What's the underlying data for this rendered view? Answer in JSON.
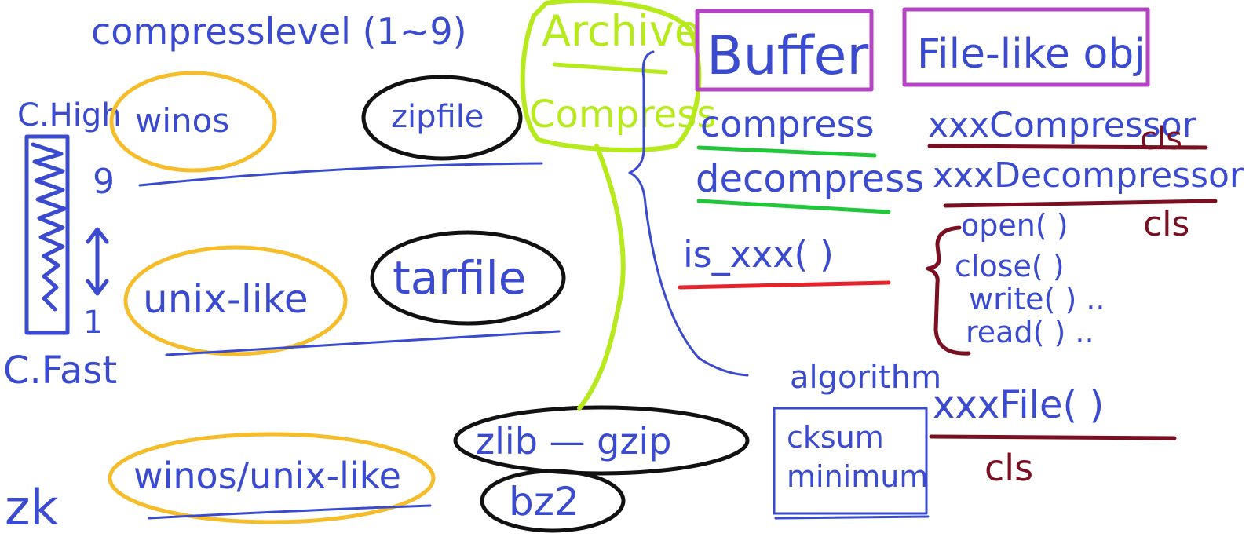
{
  "colors": {
    "blue": "#3b4bcf",
    "orange": "#f6bd2a",
    "black": "#111111",
    "lime": "#b6ea1c",
    "purple": "#b444c4",
    "green": "#22c63a",
    "red": "#e4242a",
    "maroon": "#7a0f22"
  },
  "header": {
    "compress_level": "compresslevel (1~9)"
  },
  "speed_scale": {
    "high": "C.High",
    "nine": "9",
    "one": "1",
    "fast": "C.Fast"
  },
  "platforms": {
    "winos": "winos",
    "unix_like": "unix-like",
    "both": "winos/unix-like"
  },
  "modules": {
    "zipfile": "zipfile",
    "tarfile": "tarfile",
    "zlib_gzip": "zlib — gzip",
    "bz2": "bz2"
  },
  "center": {
    "archive": "Archive",
    "compress": "Compress"
  },
  "buffer": {
    "title": "Buffer",
    "compress": "compress",
    "decompress": "decompress",
    "is_xxx": "is_xxx( )"
  },
  "file_like": {
    "title": "File-like obj",
    "compressor": "xxxCompressor",
    "decompressor": "xxxDecompressor",
    "methods": [
      "open( )",
      "close( )",
      "write( ) ..",
      "read( ) .."
    ],
    "file_class": "xxxFile( )"
  },
  "cls_labels": [
    "cls",
    "cls",
    "cls"
  ],
  "algorithm": {
    "title": "algorithm",
    "items": [
      "cksum",
      "minimum"
    ]
  },
  "corner": "zk"
}
